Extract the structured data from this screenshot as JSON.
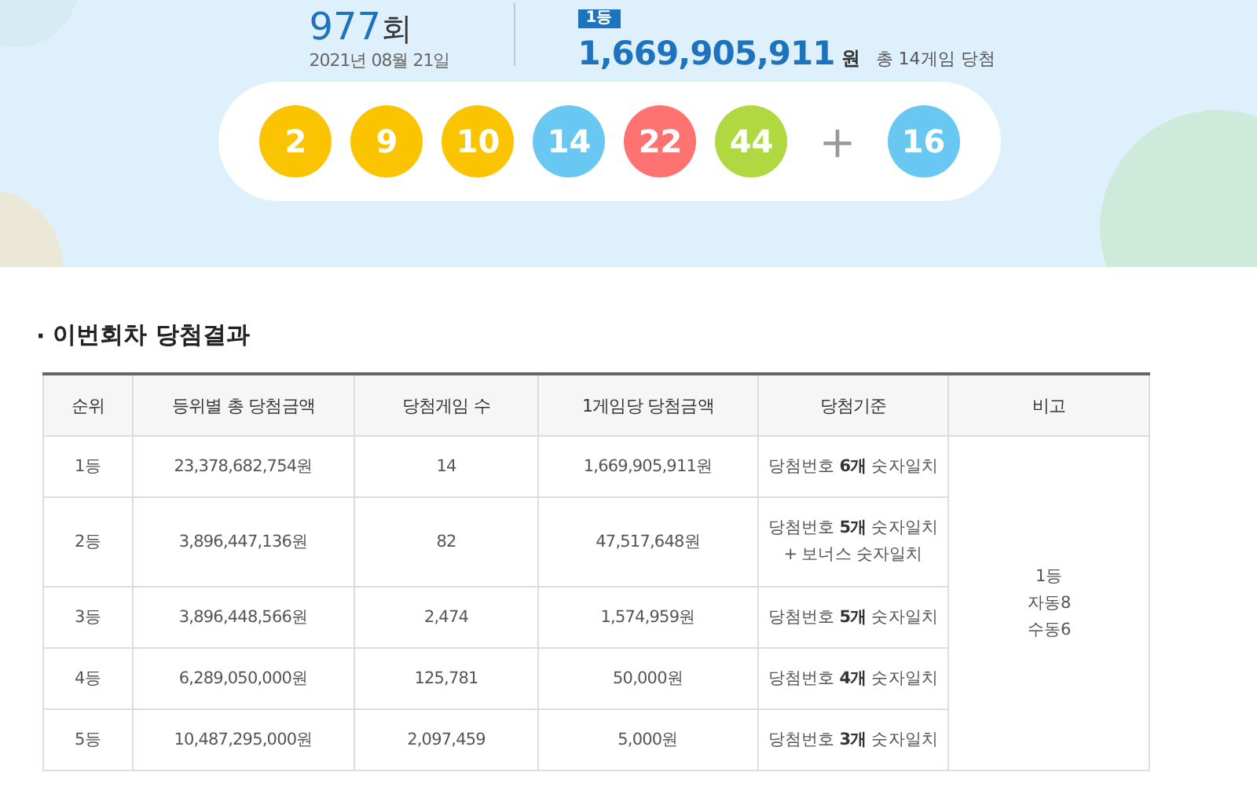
{
  "draw": {
    "round": "977",
    "round_unit": "회",
    "date": "2021년 08월 21일",
    "rank_tag": "1등",
    "prize": "1,669,905,911",
    "prize_unit": "원",
    "winners": "총 14게임 당첨"
  },
  "balls": [
    {
      "number": "2",
      "color": "#fbc400"
    },
    {
      "number": "9",
      "color": "#fbc400"
    },
    {
      "number": "10",
      "color": "#fbc400"
    },
    {
      "number": "14",
      "color": "#69c8f2"
    },
    {
      "number": "22",
      "color": "#ff7272"
    },
    {
      "number": "44",
      "color": "#b0d840"
    }
  ],
  "plus": "+",
  "bonus_ball": {
    "number": "16",
    "color": "#69c8f2"
  },
  "section_bullet": "·",
  "section_title": "이번회차 당첨결과",
  "table": {
    "columns": [
      "순위",
      "등위별 총 당첨금액",
      "당첨게임 수",
      "1게임당 당첨금액",
      "당첨기준",
      "비고"
    ],
    "rows": [
      {
        "rank": "1등",
        "total": "23,378,682,754원",
        "games": "14",
        "per_game": "1,669,905,911원",
        "criteria": [
          "당첨번호 **6개** 숫자일치"
        ]
      },
      {
        "rank": "2등",
        "total": "3,896,447,136원",
        "games": "82",
        "per_game": "47,517,648원",
        "criteria": [
          "당첨번호 **5개** 숫자일치",
          "+ 보너스 숫자일치"
        ]
      },
      {
        "rank": "3등",
        "total": "3,896,448,566원",
        "games": "2,474",
        "per_game": "1,574,959원",
        "criteria": [
          "당첨번호 **5개** 숫자일치"
        ]
      },
      {
        "rank": "4등",
        "total": "6,289,050,000원",
        "games": "125,781",
        "per_game": "50,000원",
        "criteria": [
          "당첨번호 **4개** 숫자일치"
        ]
      },
      {
        "rank": "5등",
        "total": "10,487,295,000원",
        "games": "2,097,459",
        "per_game": "5,000원",
        "criteria": [
          "당첨번호 **3개** 숫자일치"
        ]
      }
    ],
    "remarks": [
      "1등",
      "자동8",
      "수동6"
    ]
  }
}
